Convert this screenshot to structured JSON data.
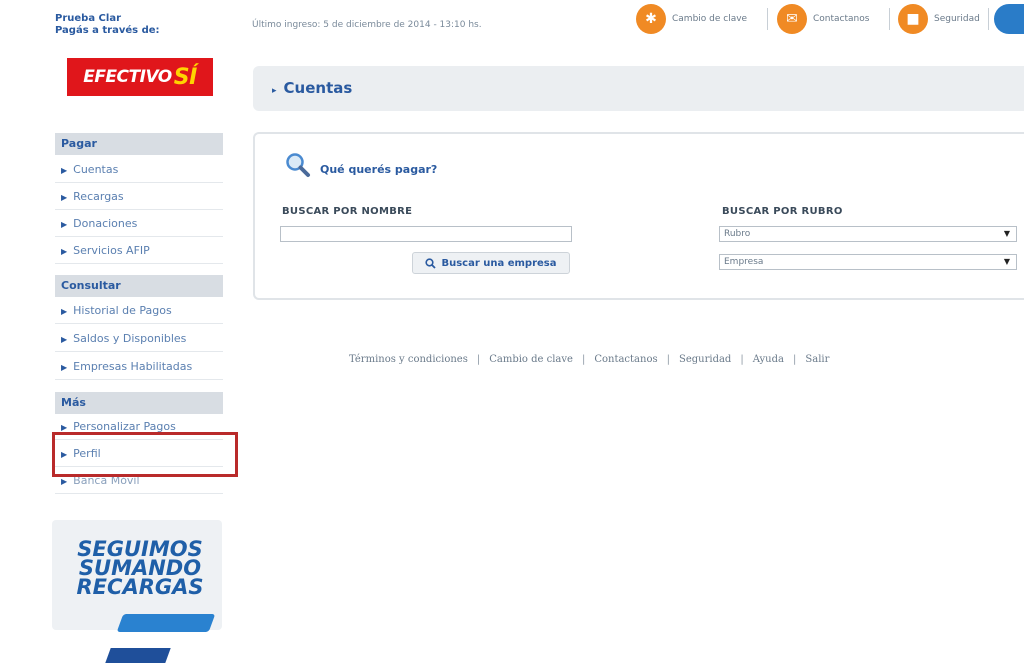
{
  "sidebar": {
    "promo_line1": "Prueba Clar",
    "promo_line2": "Pagás a través de:",
    "efectivo_logo": "EFECTIVO",
    "efectivo_si": "SÍ",
    "sections": [
      {
        "title": "Pagar",
        "items": [
          "Cuentas",
          "Recargas",
          "Donaciones",
          "Servicios AFIP"
        ]
      },
      {
        "title": "Consultar",
        "items": [
          "Historial de Pagos",
          "Saldos y Disponibles",
          "Empresas Habilitadas"
        ]
      },
      {
        "title": "Más",
        "items": [
          "Personalizar Pagos",
          "Perfil",
          "Banca Móvil"
        ]
      }
    ],
    "banner_line1": "SEGUIMOS",
    "banner_line2": "SUMANDO",
    "banner_line3": "RECARGAS"
  },
  "topbar": {
    "last_login": "Último ingreso: 5 de diciembre de 2014 - 13:10 hs.",
    "links": [
      "Cambio de clave",
      "Contactanos",
      "Seguridad"
    ]
  },
  "header": {
    "title": "Cuentas"
  },
  "panel": {
    "question": "Qué querés pagar?",
    "search_by_name_label": "BUSCAR POR NOMBRE",
    "search_by_name_value": "",
    "search_button": "Buscar una empresa",
    "search_by_category_label": "BUSCAR POR RUBRO",
    "select_rubro": "Rubro",
    "select_empresa": "Empresa"
  },
  "footer": {
    "links": [
      "Términos y condiciones",
      "Cambio de clave",
      "Contactanos",
      "Seguridad",
      "Ayuda",
      "Salir"
    ]
  },
  "colors": {
    "accent": "#2a5aa0",
    "efectivo_red": "#e0161b",
    "highlight": "#b92a2a",
    "top_icon_orange": "#f08a24"
  }
}
